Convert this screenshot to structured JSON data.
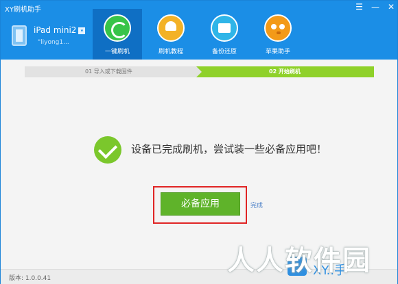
{
  "app": {
    "title": "XY刷机助手"
  },
  "window_controls": {
    "menu": "☰",
    "minimize": "—",
    "close": "✕"
  },
  "device": {
    "name": "iPad mini2",
    "dropdown": "▾",
    "user": "\"liyong1..."
  },
  "nav": {
    "items": [
      {
        "label": "一键刷机",
        "icon": "refresh-icon"
      },
      {
        "label": "刷机教程",
        "icon": "lamp-icon"
      },
      {
        "label": "备份还原",
        "icon": "backup-icon"
      },
      {
        "label": "苹果助手",
        "icon": "owl-icon"
      }
    ]
  },
  "steps": {
    "step1": "01 导入或下载固件",
    "step2": "02 开始刷机"
  },
  "main": {
    "message": "设备已完成刷机，尝试装一些必备应用吧！",
    "primary_button": "必备应用",
    "done_link": "完成"
  },
  "footer": {
    "version": "版本: 1.0.0.41"
  },
  "watermark": {
    "text": "人人软件园",
    "corner": "XY..手"
  },
  "colors": {
    "header": "#1b8ee6",
    "accent_green": "#5fb32a",
    "step_active": "#8fd12a",
    "highlight": "#e02424"
  }
}
